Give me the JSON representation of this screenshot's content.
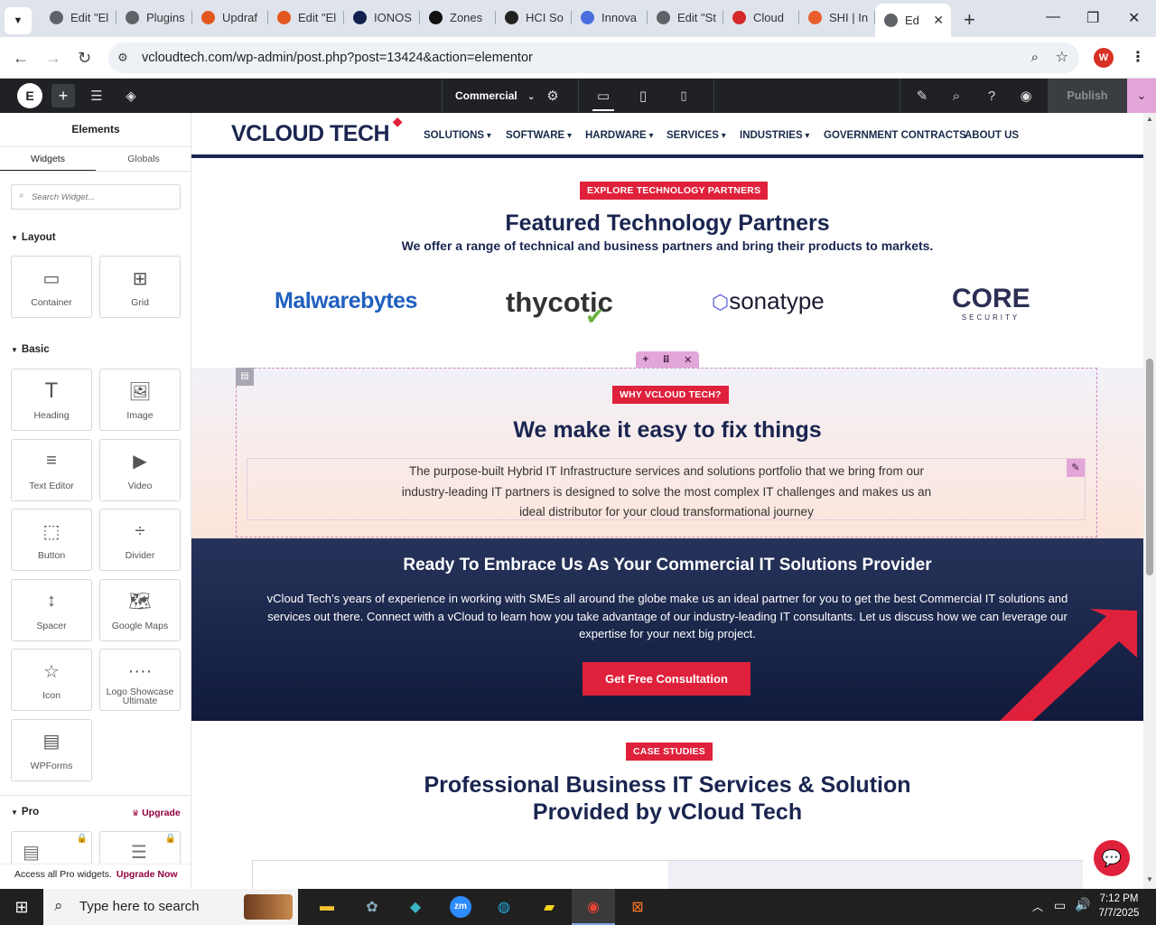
{
  "browser": {
    "tabs": [
      {
        "label": "Edit \"El",
        "color": "#5f6368"
      },
      {
        "label": "Plugins",
        "color": "#5f6368"
      },
      {
        "label": "Updraf",
        "color": "#e2571e"
      },
      {
        "label": "Edit \"El",
        "color": "#e2571e"
      },
      {
        "label": "IONOS",
        "color": "#11204d"
      },
      {
        "label": "Zones",
        "color": "#111111"
      },
      {
        "label": "HCI So",
        "color": "#222222"
      },
      {
        "label": "Innova",
        "color": "#4a6ee0"
      },
      {
        "label": "Edit \"St",
        "color": "#5f6368"
      },
      {
        "label": "Cloud",
        "color": "#d62828"
      },
      {
        "label": "SHI | In",
        "color": "#e85d2a"
      },
      {
        "label": "Ed",
        "color": "#5f6368"
      }
    ],
    "url": "vcloudtech.com/wp-admin/post.php?post=13424&action=elementor",
    "profile_initial": "W"
  },
  "editor": {
    "page_template": "Commercial",
    "publish_label": "Publish"
  },
  "panel": {
    "title": "Elements",
    "tab_widgets": "Widgets",
    "tab_globals": "Globals",
    "search_placeholder": "Search Widget...",
    "cat_layout": "Layout",
    "cat_basic": "Basic",
    "cat_pro": "Pro",
    "upgrade": "Upgrade",
    "layout_widgets": [
      "Container",
      "Grid"
    ],
    "basic_widgets": [
      "Heading",
      "Image",
      "Text Editor",
      "Video",
      "Button",
      "Divider",
      "Spacer",
      "Google Maps",
      "Icon",
      "Logo Showcase Ultimate",
      "WPForms"
    ],
    "footer_text": "Access all Pro widgets.",
    "footer_link": "Upgrade Now"
  },
  "site": {
    "logo": "VCLOUD TECH",
    "nav": [
      "SOLUTIONS",
      "SOFTWARE",
      "HARDWARE",
      "SERVICES",
      "INDUSTRIES",
      "GOVERNMENT CONTRACTS",
      "ABOUT US"
    ],
    "partners_badge": "EXPLORE TECHNOLOGY PARTNERS",
    "partners_title": "Featured Technology Partners",
    "partners_subtitle": "We offer a range of technical and business partners and bring their products to markets.",
    "partner_logos": [
      "Malwarebytes",
      "thycotic",
      "sonatype",
      "CORE",
      "SECURITY"
    ],
    "why_badge": "WHY VCLOUD TECH?",
    "why_title": "We make it easy to fix things",
    "why_text": "The purpose-built Hybrid IT Infrastructure services and solutions portfolio that we bring from our industry-leading IT partners is designed to solve the most complex IT challenges and makes us an ideal distributor for your cloud transformational journey",
    "cta_title": "Ready To Embrace Us As Your Commercial IT Solutions Provider",
    "cta_text": "vCloud Tech’s years of experience in working with SMEs all around the globe make us an ideal partner for you to get the best Commercial IT solutions and services out there. Connect with a vCloud to learn how you take advantage of our industry-leading IT consultants. Let us discuss how we can leverage our expertise for your next big project.",
    "cta_button": "Get Free Consultation",
    "case_badge": "CASE STUDIES",
    "case_title_1": "Professional Business IT Services & Solution",
    "case_title_2": "Provided by vCloud Tech"
  },
  "taskbar": {
    "search_placeholder": "Type here to search",
    "time": "7:12 PM",
    "date": "7/7/2025"
  },
  "colors": {
    "accent_red": "#e0213b",
    "navy": "#1a2550",
    "elementor_bar": "#1f2124",
    "elementor_pink": "#e2a6d8"
  }
}
